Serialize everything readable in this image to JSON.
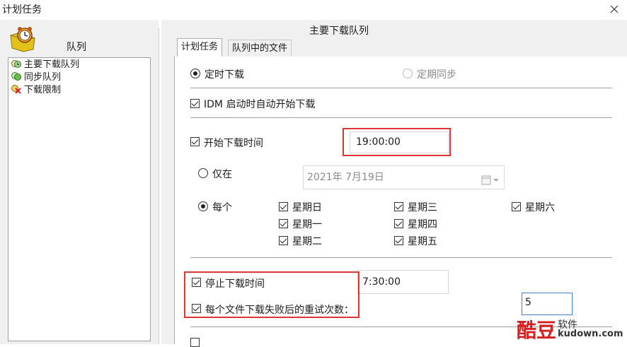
{
  "window": {
    "title": "计划任务"
  },
  "left": {
    "header": "队列",
    "items": [
      {
        "label": "主要下载队列",
        "icon": "main-queue-icon",
        "selected": true
      },
      {
        "label": "同步队列",
        "icon": "sync-queue-icon"
      },
      {
        "label": "下载限制",
        "icon": "download-limit-icon"
      }
    ]
  },
  "right": {
    "title": "主要下载队列",
    "tabs": [
      {
        "label": "计划任务",
        "active": true
      },
      {
        "label": "队列中的文件",
        "active": false
      }
    ]
  },
  "schedule": {
    "radio_one_time": "定时下载",
    "radio_periodic": "定期同步",
    "idm_start_label": "IDM 启动时自动开始下载",
    "start_time_label": "开始下载时间",
    "start_time_value": "19:00:00",
    "once_label": "仅在",
    "date_value": "2021年  7月19日",
    "every_label": "每个",
    "days": {
      "sun": "星期日",
      "mon": "星期一",
      "tue": "星期二",
      "wed": "星期三",
      "thu": "星期四",
      "fri": "星期五",
      "sat": "星期六"
    },
    "stop_time_label": "停止下载时间",
    "stop_time_value": "7:30:00",
    "retry_label": "每个文件下载失败后的重试次数：",
    "retry_value": "5"
  },
  "watermark": {
    "cn": "酷豆",
    "cn_small": "软件",
    "url": "kudown.com"
  },
  "colors": {
    "highlight": "#e03535",
    "watermark": "#d62020"
  }
}
